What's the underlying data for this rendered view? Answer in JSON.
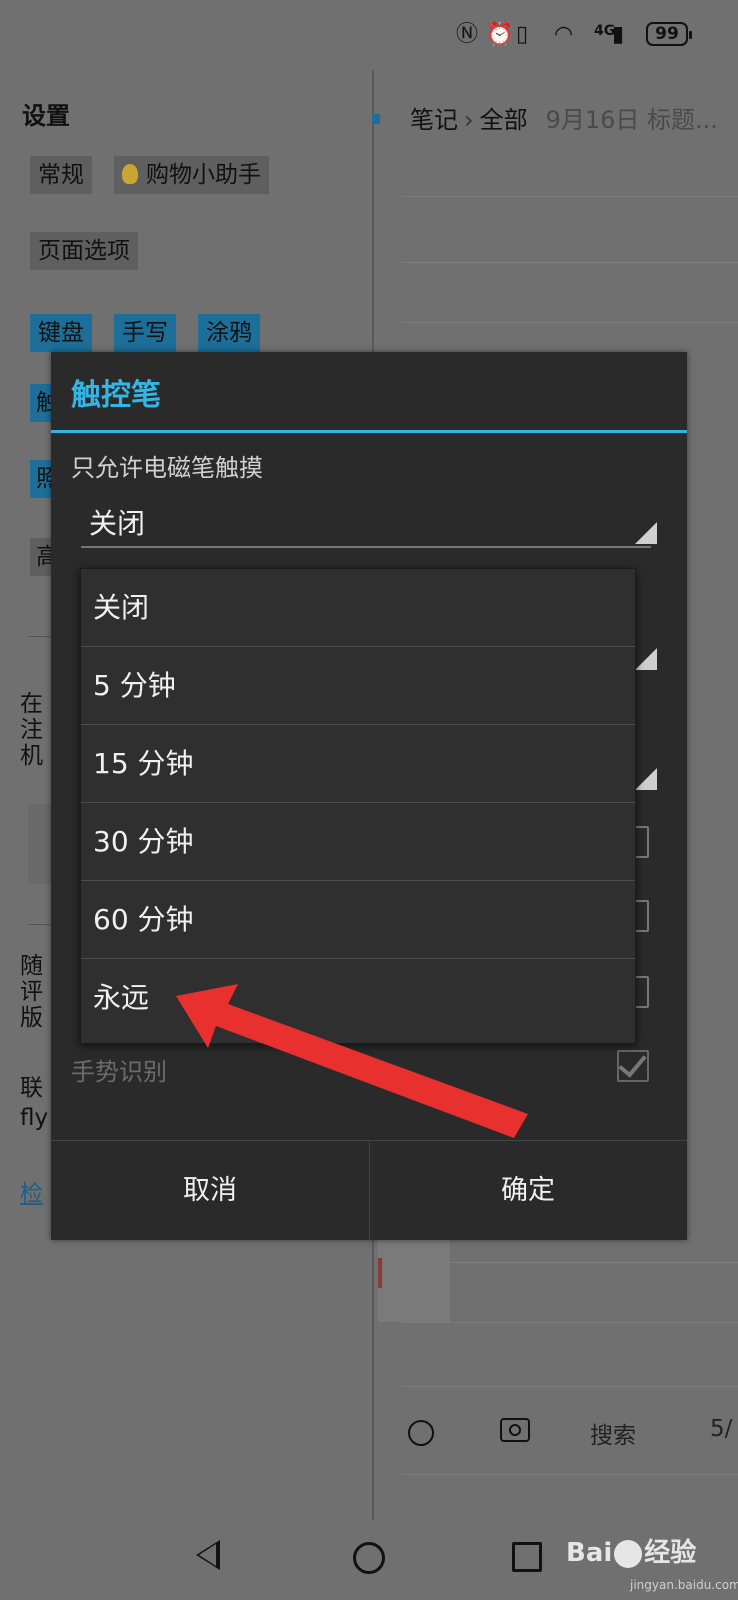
{
  "status_bar": {
    "nfc_icon": "nfc-icon",
    "alarm_icon": "alarm-icon",
    "vibrate_icon": "vibrate-icon",
    "wifi_icon": "wifi-icon",
    "signal_label": "4G",
    "battery": "99"
  },
  "settings_panel": {
    "title": "设置",
    "tabs_row1": [
      "常规",
      "购物小助手"
    ],
    "tabs_row2": [
      "页面选项"
    ],
    "tabs_row3": [
      "键盘",
      "手写",
      "涂鸦"
    ],
    "partial_tabs": [
      "触",
      "照",
      "高"
    ],
    "partial_lines": [
      "在",
      "注",
      "机",
      "随",
      "评",
      "版",
      "联",
      "fly"
    ],
    "link_text": "检"
  },
  "notes_panel": {
    "breadcrumb_root": "笔记",
    "breadcrumb_sep": "›",
    "breadcrumb_current": "全部",
    "breadcrumb_date": "9月16日 标题..."
  },
  "notes_toolbar": {
    "search_label": "搜索",
    "page_label": "5/"
  },
  "dialog": {
    "title": "触控笔",
    "setting_label": "只允许电磁笔触摸",
    "selected_value": "关闭",
    "gesture_label": "手势识别",
    "gesture_checked": true,
    "cancel_label": "取消",
    "ok_label": "确定"
  },
  "dropdown": {
    "options": [
      "关闭",
      "5 分钟",
      "15 分钟",
      "30 分钟",
      "60 分钟",
      "永远"
    ]
  },
  "watermark": {
    "brand": "Bai",
    "brand_tail": "经验",
    "url": "jingyan.baidu.com"
  },
  "colors": {
    "accent": "#33b5e5",
    "dialog_bg": "#2a2a2a",
    "arrow": "#e8302f"
  }
}
